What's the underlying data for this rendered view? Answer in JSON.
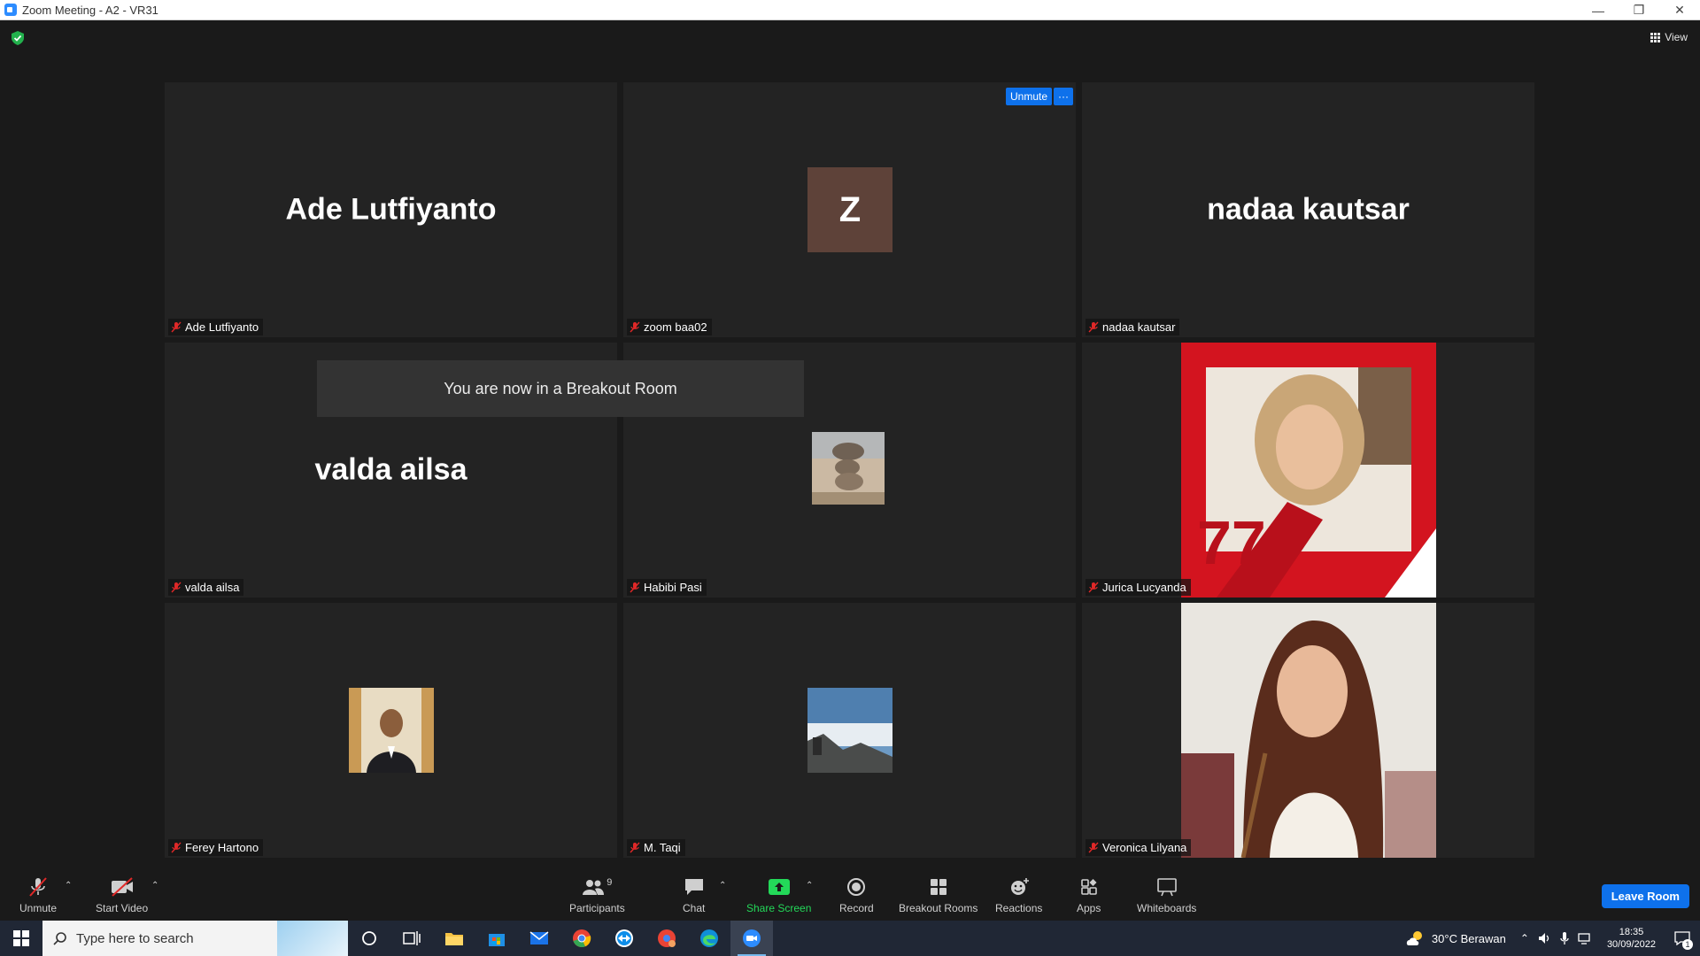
{
  "window": {
    "title": "Zoom Meeting - A2 - VR31",
    "controls": [
      "minimize",
      "restore",
      "close"
    ]
  },
  "header": {
    "view_label": "View"
  },
  "tiles": [
    {
      "display_name": "Ade Lutfiyanto",
      "label": "Ade Lutfiyanto",
      "muted": true
    },
    {
      "avatar_letter": "Z",
      "label": "zoom baa02",
      "muted": true,
      "unmute_label": "Unmute",
      "more_label": "···"
    },
    {
      "display_name": "nadaa kautsar",
      "label": "nadaa kautsar",
      "muted": true
    },
    {
      "display_name": "valda ailsa",
      "label": "valda ailsa",
      "muted": true
    },
    {
      "label": "Habibi Pasi",
      "muted": true
    },
    {
      "label": "Jurica Lucyanda",
      "muted": true
    },
    {
      "label": "Ferey Hartono",
      "muted": true
    },
    {
      "label": "M. Taqi",
      "muted": true
    },
    {
      "label": "Veronica Lilyana",
      "muted": true
    }
  ],
  "banner": {
    "text": "You are now in a Breakout Room"
  },
  "toolbar": {
    "unmute": "Unmute",
    "start_video": "Start Video",
    "participants": "Participants",
    "participants_count": "9",
    "chat": "Chat",
    "share_screen": "Share Screen",
    "record": "Record",
    "breakout_rooms": "Breakout Rooms",
    "reactions": "Reactions",
    "apps": "Apps",
    "whiteboards": "Whiteboards",
    "leave": "Leave Room"
  },
  "taskbar": {
    "search_placeholder": "Type here to search",
    "weather": "30°C  Berawan",
    "time": "18:35",
    "date": "30/09/2022",
    "notifications": "1"
  },
  "colors": {
    "accent": "#0e71eb",
    "share_green": "#23d959",
    "mute_red": "#e02828",
    "tile_bg": "#232323"
  }
}
